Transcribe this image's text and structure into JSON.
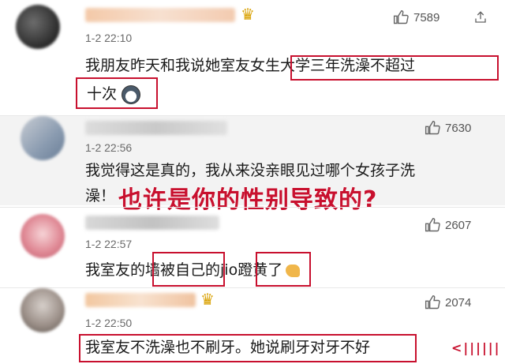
{
  "comments": [
    {
      "time": "1-2 22:10",
      "likes": "7589",
      "line1": "我朋友昨天和我说她室友",
      "line1_boxed": "女生大学三年洗澡不超过",
      "line2_boxed": "十次",
      "emoji": "husky-emoji"
    },
    {
      "time": "1-2 22:56",
      "likes": "7630",
      "line1": "我觉得这是真的，我从来没亲眼见过哪个女孩子洗",
      "line2": "澡！"
    },
    {
      "time": "1-2 22:57",
      "likes": "2607",
      "pre": "我室友的",
      "boxed1": "墙被自己",
      "mid": "的jio",
      "boxed2": "蹬黄了",
      "emoji": "muscle-emoji"
    },
    {
      "time": "1-2 22:50",
      "likes": "2074",
      "boxed": "我室友不洗澡也不刷牙。她说刷牙对牙不好"
    }
  ],
  "overlay_text": "也许是你的性别导致的?",
  "colors": {
    "accent_red": "#c8102e",
    "time_gray": "#6a6a6a"
  }
}
